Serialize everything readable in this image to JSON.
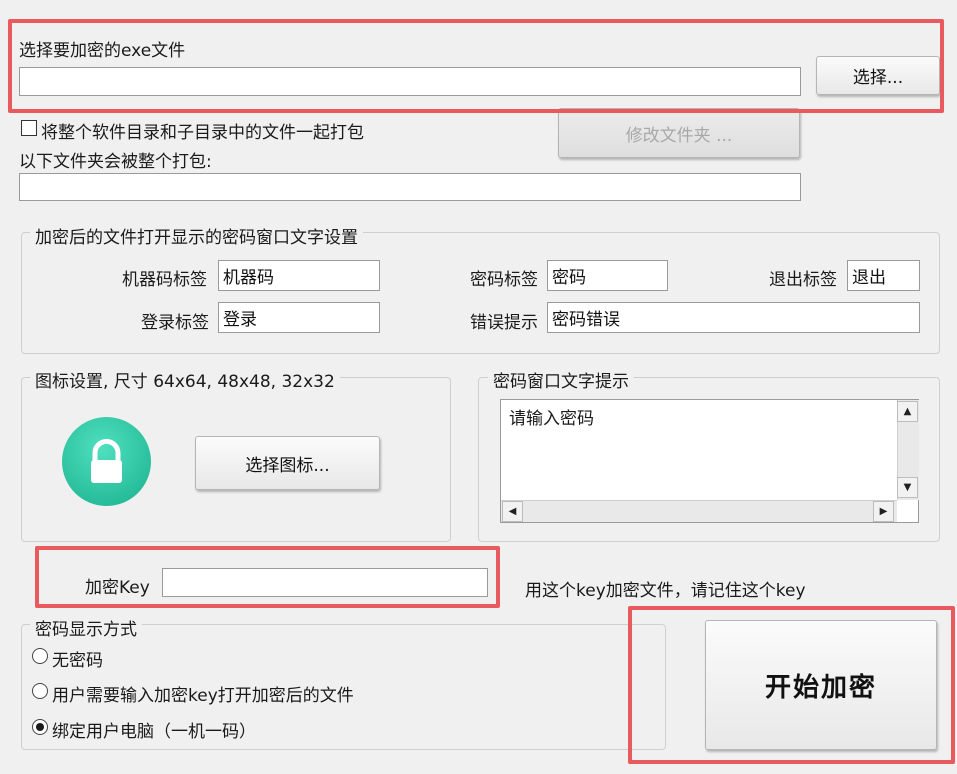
{
  "file": {
    "label": "选择要加密的exe文件",
    "path_value": "",
    "select_button": "选择..."
  },
  "package": {
    "checkbox_label": "将整个软件目录和子目录中的文件一起打包",
    "folder_label": "以下文件夹会被整个打包:",
    "folder_value": "",
    "modify_folder_button": "修改文件夹 ..."
  },
  "password_window_text": {
    "group_title": "加密后的文件打开显示的密码窗口文字设置",
    "machine_code_label": "机器码标签",
    "machine_code_value": "机器码",
    "password_label": "密码标签",
    "password_value": "密码",
    "exit_label": "退出标签",
    "exit_value": "退出",
    "login_label": "登录标签",
    "login_value": "登录",
    "error_label": "错误提示",
    "error_value": "密码错误"
  },
  "icon_settings": {
    "group_title": "图标设置, 尺寸 64x64, 48x48, 32x32",
    "select_icon_button": "选择图标...",
    "icon_color": "#2ec4a0"
  },
  "prompt": {
    "group_title": "密码窗口文字提示",
    "text": "请输入密码"
  },
  "key": {
    "label": "加密Key",
    "value": "",
    "hint": "用这个key加密文件，请记住这个key"
  },
  "display_mode": {
    "group_title": "密码显示方式",
    "options": [
      {
        "label": "无密码",
        "selected": false
      },
      {
        "label": "用户需要输入加密key打开加密后的文件",
        "selected": false
      },
      {
        "label": "绑定用户电脑（一机一码）",
        "selected": true
      }
    ]
  },
  "start_button": "开始加密",
  "highlight_color": "#e85a5e"
}
